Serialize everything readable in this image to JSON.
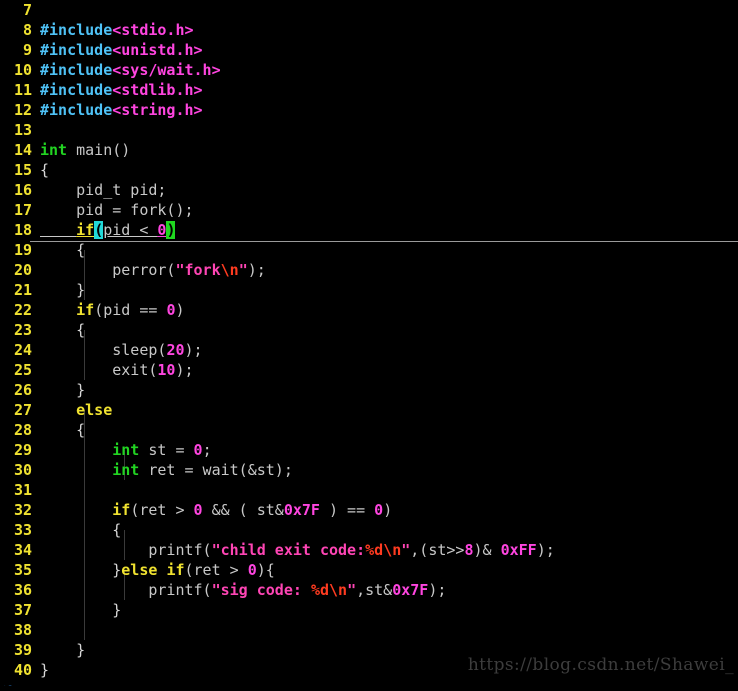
{
  "app": {
    "kind": "terminal-code-editor",
    "language": "C",
    "background_color": "#000000",
    "line_number_color": "#f0e230",
    "first_visible_line": 7,
    "last_visible_line": 40
  },
  "watermark": {
    "text": "https://blog.csdn.net/Shawei_",
    "color": "#3d3d3d"
  },
  "cursor": {
    "line": 18,
    "char": "(",
    "cursor_color": "#22d9d9",
    "match_char": ")",
    "match_color": "#1fd81f"
  },
  "status_sliver": {
    "tilde": "~",
    "color": "#2a7fd4"
  },
  "lines": [
    {
      "n": "7",
      "text": ""
    },
    {
      "n": "8",
      "text": "#include<stdio.h>"
    },
    {
      "n": "9",
      "text": "#include<unistd.h>"
    },
    {
      "n": "10",
      "text": "#include<sys/wait.h>"
    },
    {
      "n": "11",
      "text": "#include<stdlib.h>"
    },
    {
      "n": "12",
      "text": "#include<string.h>"
    },
    {
      "n": "13",
      "text": ""
    },
    {
      "n": "14",
      "text": "int main()"
    },
    {
      "n": "15",
      "text": "{"
    },
    {
      "n": "16",
      "text": "    pid_t pid;"
    },
    {
      "n": "17",
      "text": "    pid = fork();"
    },
    {
      "n": "18",
      "text": "    if(pid < 0)"
    },
    {
      "n": "19",
      "text": "    {"
    },
    {
      "n": "20",
      "text": "        perror(\"fork\\n\");"
    },
    {
      "n": "21",
      "text": "    }"
    },
    {
      "n": "22",
      "text": "    if(pid == 0)"
    },
    {
      "n": "23",
      "text": "    {"
    },
    {
      "n": "24",
      "text": "        sleep(20);"
    },
    {
      "n": "25",
      "text": "        exit(10);"
    },
    {
      "n": "26",
      "text": "    }"
    },
    {
      "n": "27",
      "text": "    else"
    },
    {
      "n": "28",
      "text": "    {"
    },
    {
      "n": "29",
      "text": "        int st = 0;"
    },
    {
      "n": "30",
      "text": "        int ret = wait(&st);"
    },
    {
      "n": "31",
      "text": ""
    },
    {
      "n": "32",
      "text": "        if(ret > 0 && ( st&0x7F ) == 0)"
    },
    {
      "n": "33",
      "text": "        {"
    },
    {
      "n": "34",
      "text": "            printf(\"child exit code:%d\\n\",(st>>8)& 0xFF);"
    },
    {
      "n": "35",
      "text": "        }else if(ret > 0){"
    },
    {
      "n": "36",
      "text": "            printf(\"sig code: %d\\n\",st&0x7F);"
    },
    {
      "n": "37",
      "text": "        }"
    },
    {
      "n": "38",
      "text": ""
    },
    {
      "n": "39",
      "text": "    }"
    },
    {
      "n": "40",
      "text": "}"
    }
  ],
  "tokens": {
    "l7": [],
    "l8": [
      {
        "t": "#include",
        "c": "preproc"
      },
      {
        "t": "<stdio.h>",
        "c": "header"
      }
    ],
    "l9": [
      {
        "t": "#include",
        "c": "preproc"
      },
      {
        "t": "<unistd.h>",
        "c": "header"
      }
    ],
    "l10": [
      {
        "t": "#include",
        "c": "preproc"
      },
      {
        "t": "<sys/wait.h>",
        "c": "header"
      }
    ],
    "l11": [
      {
        "t": "#include",
        "c": "preproc"
      },
      {
        "t": "<stdlib.h>",
        "c": "header"
      }
    ],
    "l12": [
      {
        "t": "#include",
        "c": "preproc"
      },
      {
        "t": "<string.h>",
        "c": "header"
      }
    ],
    "l13": [],
    "l14": [
      {
        "t": "int",
        "c": "type"
      },
      {
        "t": " main()",
        "c": "plain"
      }
    ],
    "l15": [
      {
        "t": "{",
        "c": "brace"
      }
    ],
    "l16": [
      {
        "t": "    pid_t pid;",
        "c": "plain"
      }
    ],
    "l17": [
      {
        "t": "    pid = fork();",
        "c": "plain"
      }
    ],
    "l18": [
      {
        "t": "    ",
        "c": "plain"
      },
      {
        "t": "if",
        "c": "keyword"
      },
      {
        "t": "(",
        "c": "cursor"
      },
      {
        "t": "pid < ",
        "c": "plain"
      },
      {
        "t": "0",
        "c": "number"
      },
      {
        "t": ")",
        "c": "match"
      }
    ],
    "l19": [
      {
        "t": "    {",
        "c": "brace"
      }
    ],
    "l20": [
      {
        "t": "        perror(",
        "c": "plain"
      },
      {
        "t": "\"fork",
        "c": "string"
      },
      {
        "t": "\\n",
        "c": "escape"
      },
      {
        "t": "\"",
        "c": "string"
      },
      {
        "t": ");",
        "c": "plain"
      }
    ],
    "l21": [
      {
        "t": "    }",
        "c": "brace"
      }
    ],
    "l22": [
      {
        "t": "    ",
        "c": "plain"
      },
      {
        "t": "if",
        "c": "keyword"
      },
      {
        "t": "(pid == ",
        "c": "plain"
      },
      {
        "t": "0",
        "c": "number"
      },
      {
        "t": ")",
        "c": "plain"
      }
    ],
    "l23": [
      {
        "t": "    {",
        "c": "brace"
      }
    ],
    "l24": [
      {
        "t": "        sleep(",
        "c": "plain"
      },
      {
        "t": "20",
        "c": "number"
      },
      {
        "t": ");",
        "c": "plain"
      }
    ],
    "l25": [
      {
        "t": "        exit(",
        "c": "plain"
      },
      {
        "t": "10",
        "c": "number"
      },
      {
        "t": ");",
        "c": "plain"
      }
    ],
    "l26": [
      {
        "t": "    }",
        "c": "brace"
      }
    ],
    "l27": [
      {
        "t": "    ",
        "c": "plain"
      },
      {
        "t": "else",
        "c": "keyword"
      }
    ],
    "l28": [
      {
        "t": "    {",
        "c": "brace"
      }
    ],
    "l29": [
      {
        "t": "        ",
        "c": "plain"
      },
      {
        "t": "int",
        "c": "type"
      },
      {
        "t": " st = ",
        "c": "plain"
      },
      {
        "t": "0",
        "c": "number"
      },
      {
        "t": ";",
        "c": "plain"
      }
    ],
    "l30": [
      {
        "t": "        ",
        "c": "plain"
      },
      {
        "t": "int",
        "c": "type"
      },
      {
        "t": " ret = wait(&st);",
        "c": "plain"
      }
    ],
    "l31": [],
    "l32": [
      {
        "t": "        ",
        "c": "plain"
      },
      {
        "t": "if",
        "c": "keyword"
      },
      {
        "t": "(ret > ",
        "c": "plain"
      },
      {
        "t": "0",
        "c": "number"
      },
      {
        "t": " && ( st&",
        "c": "plain"
      },
      {
        "t": "0x7F",
        "c": "number"
      },
      {
        "t": " ) == ",
        "c": "plain"
      },
      {
        "t": "0",
        "c": "number"
      },
      {
        "t": ")",
        "c": "plain"
      }
    ],
    "l33": [
      {
        "t": "        {",
        "c": "brace"
      }
    ],
    "l34": [
      {
        "t": "            printf(",
        "c": "plain"
      },
      {
        "t": "\"child exit code:",
        "c": "string"
      },
      {
        "t": "%d",
        "c": "escape"
      },
      {
        "t": "\\n",
        "c": "escape"
      },
      {
        "t": "\"",
        "c": "string"
      },
      {
        "t": ",(st>>",
        "c": "plain"
      },
      {
        "t": "8",
        "c": "number"
      },
      {
        "t": ")& ",
        "c": "plain"
      },
      {
        "t": "0xFF",
        "c": "number"
      },
      {
        "t": ");",
        "c": "plain"
      }
    ],
    "l35": [
      {
        "t": "        }",
        "c": "brace"
      },
      {
        "t": "else",
        "c": "keyword"
      },
      {
        "t": " ",
        "c": "plain"
      },
      {
        "t": "if",
        "c": "keyword"
      },
      {
        "t": "(ret > ",
        "c": "plain"
      },
      {
        "t": "0",
        "c": "number"
      },
      {
        "t": "){",
        "c": "plain"
      }
    ],
    "l36": [
      {
        "t": "            printf(",
        "c": "plain"
      },
      {
        "t": "\"sig code: ",
        "c": "string"
      },
      {
        "t": "%d",
        "c": "escape"
      },
      {
        "t": "\\n",
        "c": "escape"
      },
      {
        "t": "\"",
        "c": "string"
      },
      {
        "t": ",st&",
        "c": "plain"
      },
      {
        "t": "0x7F",
        "c": "number"
      },
      {
        "t": ");",
        "c": "plain"
      }
    ],
    "l37": [
      {
        "t": "        }",
        "c": "brace"
      }
    ],
    "l38": [],
    "l39": [
      {
        "t": "    }",
        "c": "brace"
      }
    ],
    "l40": [
      {
        "t": "}",
        "c": "brace"
      }
    ]
  }
}
